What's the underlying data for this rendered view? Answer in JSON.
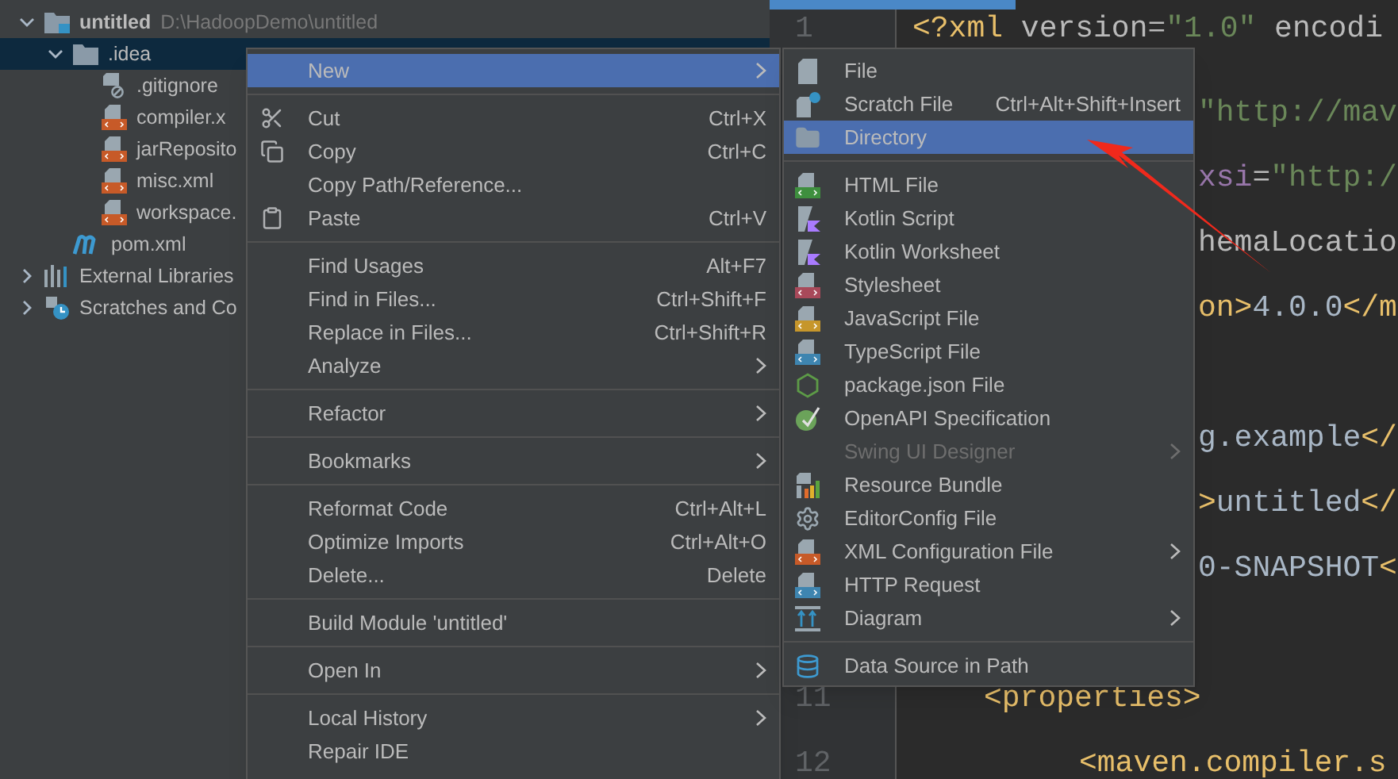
{
  "project_tree": [
    {
      "label": "untitled",
      "path": "D:\\HadoopDemo\\untitled",
      "expanded": true,
      "selected": false,
      "children": [
        {
          "label": ".idea",
          "expanded": true,
          "selected": true,
          "children": [
            {
              "label": ".gitignore"
            },
            {
              "label": "compiler.x"
            },
            {
              "label": "jarReposito"
            },
            {
              "label": "misc.xml"
            },
            {
              "label": "workspace."
            }
          ]
        },
        {
          "label": "pom.xml"
        }
      ]
    },
    {
      "label": "External Libraries",
      "expanded": false,
      "selected": false
    },
    {
      "label": "Scratches and Co",
      "expanded": false,
      "selected": false
    }
  ],
  "editor": {
    "lines": [
      {
        "number": "1",
        "kind": "start",
        "tokens": [
          {
            "kind": "tag",
            "text": "<?xml"
          },
          {
            "kind": "attr",
            "text": " version="
          },
          {
            "kind": "string",
            "text": "\"1.0\""
          },
          {
            "kind": "attr",
            "text": " encodi"
          }
        ]
      },
      {
        "kind": "tail",
        "tokens": [
          {
            "kind": "string",
            "text": "\"http://mav"
          }
        ]
      },
      {
        "kind": "tail",
        "tokens": [
          {
            "kind": "ns",
            "text": "xsi"
          },
          {
            "kind": "attr",
            "text": "="
          },
          {
            "kind": "string",
            "text": "\"http:/"
          }
        ]
      },
      {
        "kind": "tail",
        "tokens": [
          {
            "kind": "attr",
            "text": "hemaLocatio"
          }
        ]
      },
      {
        "kind": "tail",
        "tokens": [
          {
            "kind": "tag",
            "text": "on>"
          },
          {
            "kind": "text",
            "text": "4.0.0"
          },
          {
            "kind": "tag",
            "text": "</m"
          }
        ]
      },
      {
        "kind": "tail"
      },
      {
        "kind": "tail",
        "tokens": [
          {
            "kind": "text",
            "text": "g.example"
          },
          {
            "kind": "tag",
            "text": "</"
          }
        ]
      },
      {
        "kind": "tail",
        "tokens": [
          {
            "kind": "tag",
            "text": ">"
          },
          {
            "kind": "text",
            "text": "untitled"
          },
          {
            "kind": "tag",
            "text": "</"
          }
        ]
      },
      {
        "kind": "tail",
        "tokens": [
          {
            "kind": "text",
            "text": "0-SNAPSHOT"
          },
          {
            "kind": "tag",
            "text": "<"
          }
        ]
      },
      {
        "kind": "tail"
      },
      {
        "number": "11",
        "kind": "nested",
        "tokens": [
          {
            "kind": "tag",
            "text": "<properties>"
          }
        ]
      },
      {
        "number": "12",
        "kind": "nested2",
        "tokens": [
          {
            "kind": "tag",
            "text": "<maven.compiler.s"
          }
        ]
      }
    ]
  },
  "context_menu": {
    "groups": [
      [
        {
          "label": "New",
          "submenu": true,
          "selected": true
        }
      ],
      [
        {
          "label": "Cut",
          "shortcut": "Ctrl+X",
          "submenu": false,
          "selected": false
        },
        {
          "label": "Copy",
          "shortcut": "Ctrl+C",
          "submenu": false,
          "selected": false
        },
        {
          "label": "Copy Path/Reference...",
          "submenu": false,
          "selected": false
        },
        {
          "label": "Paste",
          "shortcut": "Ctrl+V",
          "submenu": false,
          "selected": false
        }
      ],
      [
        {
          "label": "Find Usages",
          "shortcut": "Alt+F7",
          "submenu": false,
          "selected": false
        },
        {
          "label": "Find in Files...",
          "shortcut": "Ctrl+Shift+F",
          "submenu": false,
          "selected": false
        },
        {
          "label": "Replace in Files...",
          "shortcut": "Ctrl+Shift+R",
          "submenu": false,
          "selected": false
        },
        {
          "label": "Analyze",
          "submenu": true,
          "selected": false
        }
      ],
      [
        {
          "label": "Refactor",
          "submenu": true,
          "selected": false
        }
      ],
      [
        {
          "label": "Bookmarks",
          "submenu": true,
          "selected": false
        }
      ],
      [
        {
          "label": "Reformat Code",
          "shortcut": "Ctrl+Alt+L",
          "submenu": false,
          "selected": false
        },
        {
          "label": "Optimize Imports",
          "shortcut": "Ctrl+Alt+O",
          "submenu": false,
          "selected": false
        },
        {
          "label": "Delete...",
          "shortcut": "Delete",
          "submenu": false,
          "selected": false
        }
      ],
      [
        {
          "label": "Build Module 'untitled'",
          "submenu": false,
          "selected": false
        }
      ],
      [
        {
          "label": "Open In",
          "submenu": true,
          "selected": false
        }
      ],
      [
        {
          "label": "Local History",
          "submenu": true,
          "selected": false
        },
        {
          "label": "Repair IDE",
          "submenu": false,
          "selected": false
        }
      ]
    ]
  },
  "new_submenu": {
    "groups": [
      [
        {
          "label": "File",
          "submenu": false,
          "disabled": false,
          "selected": false
        },
        {
          "label": "Scratch File",
          "shortcut": "Ctrl+Alt+Shift+Insert",
          "submenu": false,
          "disabled": false,
          "selected": false
        },
        {
          "label": "Directory",
          "submenu": false,
          "disabled": false,
          "selected": true
        }
      ],
      [
        {
          "label": "HTML File",
          "submenu": false,
          "disabled": false,
          "selected": false
        },
        {
          "label": "Kotlin Script",
          "submenu": false,
          "disabled": false,
          "selected": false
        },
        {
          "label": "Kotlin Worksheet",
          "submenu": false,
          "disabled": false,
          "selected": false
        },
        {
          "label": "Stylesheet",
          "submenu": false,
          "disabled": false,
          "selected": false
        },
        {
          "label": "JavaScript File",
          "submenu": false,
          "disabled": false,
          "selected": false
        },
        {
          "label": "TypeScript File",
          "submenu": false,
          "disabled": false,
          "selected": false
        },
        {
          "label": "package.json File",
          "submenu": false,
          "disabled": false,
          "selected": false
        },
        {
          "label": "OpenAPI Specification",
          "submenu": false,
          "disabled": false,
          "selected": false
        },
        {
          "label": "Swing UI Designer",
          "submenu": true,
          "disabled": true,
          "selected": false
        },
        {
          "label": "Resource Bundle",
          "submenu": false,
          "disabled": false,
          "selected": false
        },
        {
          "label": "EditorConfig File",
          "submenu": false,
          "disabled": false,
          "selected": false
        },
        {
          "label": "XML Configuration File",
          "submenu": true,
          "disabled": false,
          "selected": false
        },
        {
          "label": "HTTP Request",
          "submenu": false,
          "disabled": false,
          "selected": false
        },
        {
          "label": "Diagram",
          "submenu": true,
          "disabled": false,
          "selected": false
        }
      ],
      [
        {
          "label": "Data Source in Path",
          "submenu": false,
          "disabled": false,
          "selected": false
        }
      ]
    ]
  }
}
